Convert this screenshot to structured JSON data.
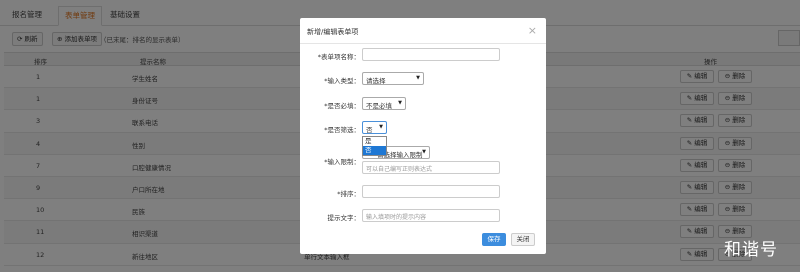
{
  "tabs": [
    {
      "label": "报名管理"
    },
    {
      "label": "表单管理"
    },
    {
      "label": "基础设置"
    }
  ],
  "toolbar": {
    "refresh_label": "⟳ 刷新",
    "add_label": "⊕ 添加表单项",
    "note": "（已末尾：排名的显示表单）"
  },
  "table": {
    "headers": {
      "index": "排序",
      "name": "提示名称",
      "actions": "操作"
    },
    "rows": [
      {
        "index": "1",
        "name": "学生姓名",
        "edit": "✎ 编辑",
        "delete": "⊖ 删除"
      },
      {
        "index": "1",
        "name": "身份证号",
        "edit": "✎ 编辑",
        "delete": "⊖ 删除"
      },
      {
        "index": "3",
        "name": "联系电话",
        "edit": "✎ 编辑",
        "delete": "⊖ 删除"
      },
      {
        "index": "4",
        "name": "性别",
        "edit": "✎ 编辑",
        "delete": "⊖ 删除"
      },
      {
        "index": "7",
        "name": "口腔健康情况",
        "edit": "✎ 编辑",
        "delete": "⊖ 删除"
      },
      {
        "index": "9",
        "name": "户口所在地",
        "edit": "✎ 编辑",
        "delete": "⊖ 删除"
      },
      {
        "index": "10",
        "name": "民族",
        "edit": "✎ 编辑",
        "delete": "⊖ 删除"
      },
      {
        "index": "11",
        "name": "相识渠道",
        "edit": "✎ 编辑",
        "delete": "⊖ 删除"
      },
      {
        "index": "12",
        "name": "新往地区",
        "edit": "✎ 编辑",
        "delete": "⊖ 删除"
      }
    ],
    "last_row_extra": "单行文本输入框"
  },
  "modal": {
    "title": "新增/编辑表单项",
    "close": "×",
    "fields": {
      "name_label": "*表单项名称：",
      "name_value": "",
      "type_label": "*输入类型：",
      "type_value": "请选择",
      "required_label": "*是否必填：",
      "required_value": "不是必填",
      "filter_label": "*是否筛选：",
      "filter_value": "否",
      "limit_label": "*输入限制：",
      "limit_value": "请选择输入限制",
      "limit_placeholder": "可以自己编写正则表达式",
      "sort_label": "*排序：",
      "sort_value": "",
      "hint_label": "提示文字：",
      "hint_placeholder": "输入填项时的提示内容"
    },
    "filter_options": [
      {
        "label": "是",
        "selected": false
      },
      {
        "label": "否",
        "selected": true
      }
    ],
    "save_label": "保存",
    "close_label": "关闭"
  },
  "watermark": "和谐号",
  "colors": {
    "accent": "#e0731b",
    "primary": "#3c8dde",
    "dropdown_selected": "#1e78d4"
  }
}
